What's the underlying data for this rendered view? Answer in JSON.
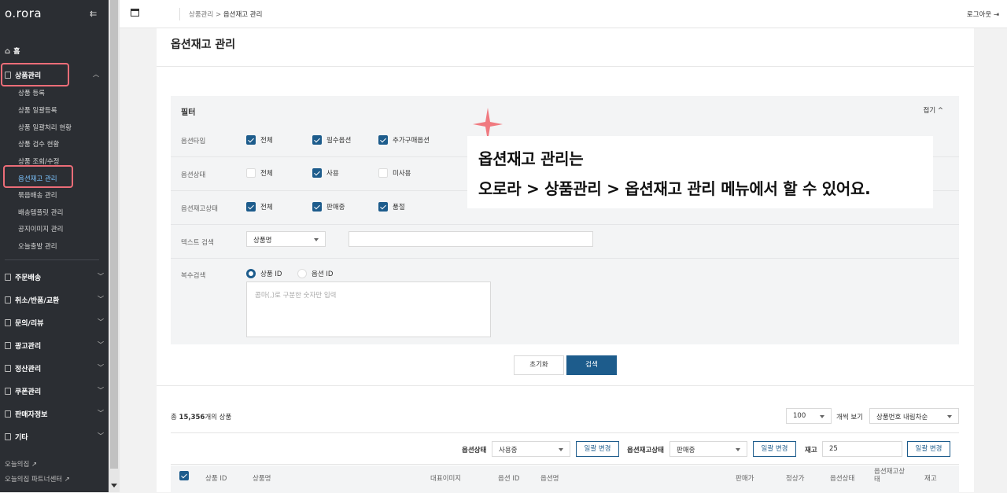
{
  "sidebar": {
    "logo": "o.rora",
    "collapse_icon": "collapse-left-icon",
    "items": [
      {
        "label": "홈",
        "icon": "home-icon"
      },
      {
        "label": "상품관리",
        "icon": "document-icon",
        "expanded": true
      },
      {
        "label": "주문배송",
        "icon": "document-icon"
      },
      {
        "label": "취소/반품/교환",
        "icon": "document-icon"
      },
      {
        "label": "문의/리뷰",
        "icon": "document-icon"
      },
      {
        "label": "광고관리",
        "icon": "document-icon"
      },
      {
        "label": "정산관리",
        "icon": "document-icon"
      },
      {
        "label": "쿠폰관리",
        "icon": "document-icon"
      },
      {
        "label": "판매자정보",
        "icon": "document-icon"
      },
      {
        "label": "기타",
        "icon": "document-icon"
      }
    ],
    "subitems": [
      "상품 등록",
      "상품 일괄등록",
      "상품 일괄처리 현황",
      "상품 검수 현황",
      "상품 조회/수정",
      "옵션재고 관리",
      "묶음배송 관리",
      "배송템플릿 관리",
      "공지이미지 관리",
      "오늘출발 관리"
    ],
    "active_subitem": "옵션재고 관리",
    "footer": [
      "오늘의집",
      "오늘의집 파트너센터"
    ]
  },
  "header": {
    "breadcrumb_parent": "상품관리",
    "breadcrumb_sep": ">",
    "breadcrumb_current": "옵션재고 관리",
    "logout": "로그아웃"
  },
  "page": {
    "title": "옵션재고 관리"
  },
  "filter": {
    "title": "필터",
    "fold_label": "접기",
    "option_type": {
      "label": "옵션타입",
      "options": [
        {
          "label": "전체",
          "checked": true
        },
        {
          "label": "필수옵션",
          "checked": true
        },
        {
          "label": "추가구매옵션",
          "checked": true
        }
      ]
    },
    "option_status": {
      "label": "옵션상태",
      "options": [
        {
          "label": "전체",
          "checked": false
        },
        {
          "label": "사용",
          "checked": true
        },
        {
          "label": "미사용",
          "checked": false
        }
      ]
    },
    "stock_status": {
      "label": "옵션재고상태",
      "options": [
        {
          "label": "전체",
          "checked": true
        },
        {
          "label": "판매중",
          "checked": true
        },
        {
          "label": "품절",
          "checked": true
        }
      ]
    },
    "text_search": {
      "label": "텍스트 검색",
      "select": "상품명",
      "value": ""
    },
    "multi_search": {
      "label": "복수검색",
      "options": [
        {
          "label": "상품 ID",
          "selected": true
        },
        {
          "label": "옵션 ID",
          "selected": false
        }
      ],
      "placeholder": "콤마(,)로 구분한 숫자만 입력"
    },
    "reset_button": "초기화",
    "search_button": "검색"
  },
  "results": {
    "count_prefix": "총",
    "count": "15,356",
    "count_suffix": "개의 상품",
    "page_size": "100",
    "page_size_label": "개씩 보기",
    "sort": "상품번호 내림차순"
  },
  "bulk": {
    "status_label": "옵션상태",
    "status_value": "사용중",
    "status_button": "일괄 변경",
    "stock_label": "옵션재고상태",
    "stock_value": "판매중",
    "stock_button": "일괄 변경",
    "qty_label": "재고",
    "qty_value": "25",
    "qty_button": "일괄 변경"
  },
  "table": {
    "columns": [
      "상품 ID",
      "상품명",
      "대표이미지",
      "옵션 ID",
      "옵션명",
      "판매가",
      "정상가",
      "옵션상태",
      "옵션재고상태",
      "재고"
    ]
  },
  "tooltip": {
    "line1": "옵션재고 관리는",
    "line2": "오로라 > 상품관리 > 옵션재고 관리 메뉴에서 할 수 있어요."
  },
  "colors": {
    "accent": "#1d5c8c",
    "highlight": "#ec6d78",
    "sidebar_bg": "#2b2e33",
    "sparkle": "#f07a80"
  }
}
